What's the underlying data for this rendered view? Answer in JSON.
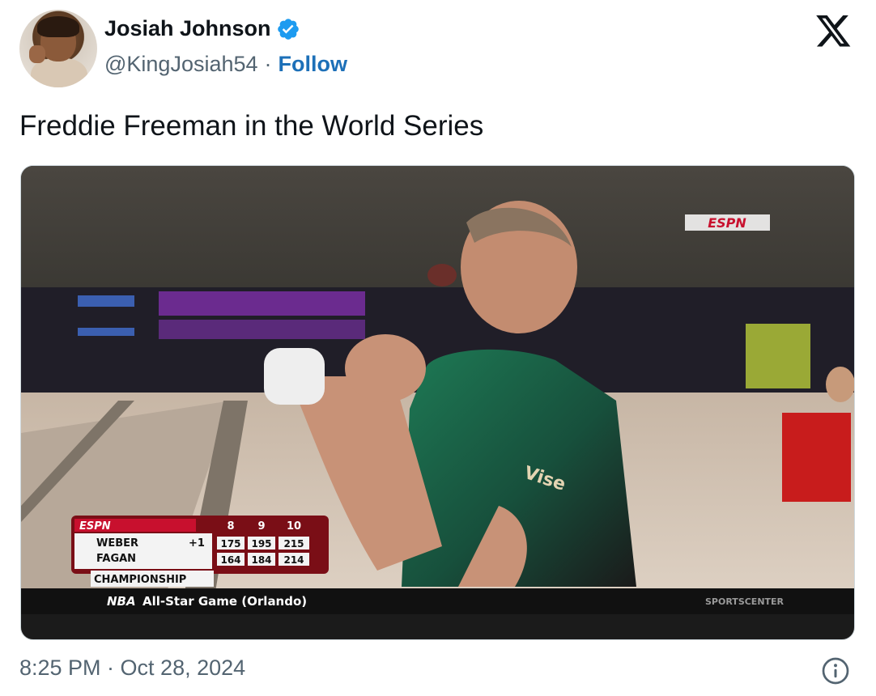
{
  "author": {
    "display_name": "Josiah Johnson",
    "handle": "@KingJosiah54",
    "separator": "·",
    "follow_label": "Follow",
    "verified": true
  },
  "tweet": {
    "text": "Freddie Freeman in the World Series",
    "timestamp": "8:25 PM · Oct 28, 2024"
  },
  "video": {
    "network_logo": "ESPN",
    "scoreboard": {
      "network": "ESPN",
      "frames": [
        "8",
        "9",
        "10"
      ],
      "players": [
        {
          "name": "WEBER",
          "lead": "+1",
          "scores": [
            "175",
            "195",
            "215"
          ]
        },
        {
          "name": "FAGAN",
          "lead": "",
          "scores": [
            "164",
            "184",
            "214"
          ]
        }
      ],
      "event": "CHAMPIONSHIP"
    },
    "ticker": {
      "league": "NBA",
      "text": "All-Star Game (Orlando)",
      "show": "SPORTSCENTER"
    },
    "shirt_text": "Vise"
  },
  "colors": {
    "brand_blue": "#1d9bf0",
    "follow_blue": "#1d70b8",
    "espn_red": "#c8102e"
  },
  "icons": [
    "verified-badge-icon",
    "x-logo-icon",
    "info-icon"
  ]
}
